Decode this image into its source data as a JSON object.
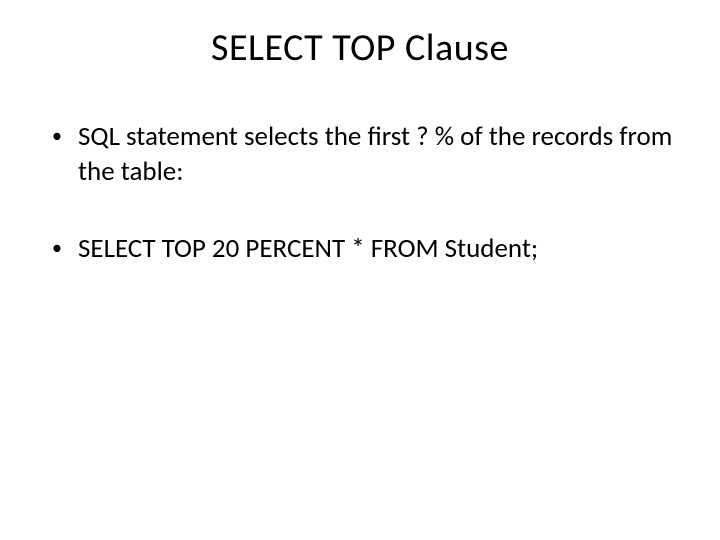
{
  "slide": {
    "title": "SELECT TOP Clause",
    "bullets": [
      {
        "marker": "•",
        "text": "SQL statement selects the first ? % of the records from the table:"
      },
      {
        "marker": "•",
        "text": "SELECT TOP 20 PERCENT * FROM Student;"
      }
    ]
  }
}
